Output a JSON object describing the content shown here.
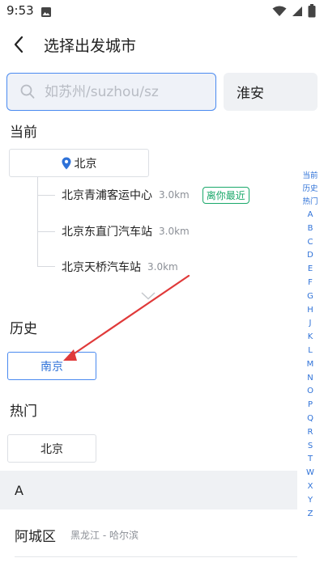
{
  "status_bar": {
    "time": "9:53"
  },
  "header": {
    "title": "选择出发城市"
  },
  "search": {
    "placeholder": "如苏州/suzhou/sz",
    "value": ""
  },
  "selected_city": "淮安",
  "current": {
    "title": "当前",
    "city": "北京",
    "stations": [
      {
        "name": "北京青浦客运中心",
        "distance": "3.0km",
        "badge": "离你最近"
      },
      {
        "name": "北京东直门汽车站",
        "distance": "3.0km",
        "badge": ""
      },
      {
        "name": "北京天桥汽车站",
        "distance": "3.0km",
        "badge": ""
      }
    ]
  },
  "history": {
    "title": "历史",
    "cities": [
      "南京"
    ]
  },
  "hot": {
    "title": "热门",
    "cities": [
      "北京"
    ]
  },
  "groups": [
    {
      "letter": "A",
      "cities": [
        {
          "name": "阿城区",
          "sub": "黑龙江 - 哈尔滨"
        }
      ]
    }
  ],
  "index": [
    "当前",
    "历史",
    "热门",
    "A",
    "B",
    "C",
    "D",
    "E",
    "F",
    "G",
    "H",
    "J",
    "K",
    "L",
    "M",
    "N",
    "O",
    "P",
    "Q",
    "R",
    "S",
    "T",
    "W",
    "X",
    "Y",
    "Z"
  ],
  "colors": {
    "accent": "#2f72d8",
    "nearest": "#1aa86a",
    "annotation": "#e03a3a"
  }
}
